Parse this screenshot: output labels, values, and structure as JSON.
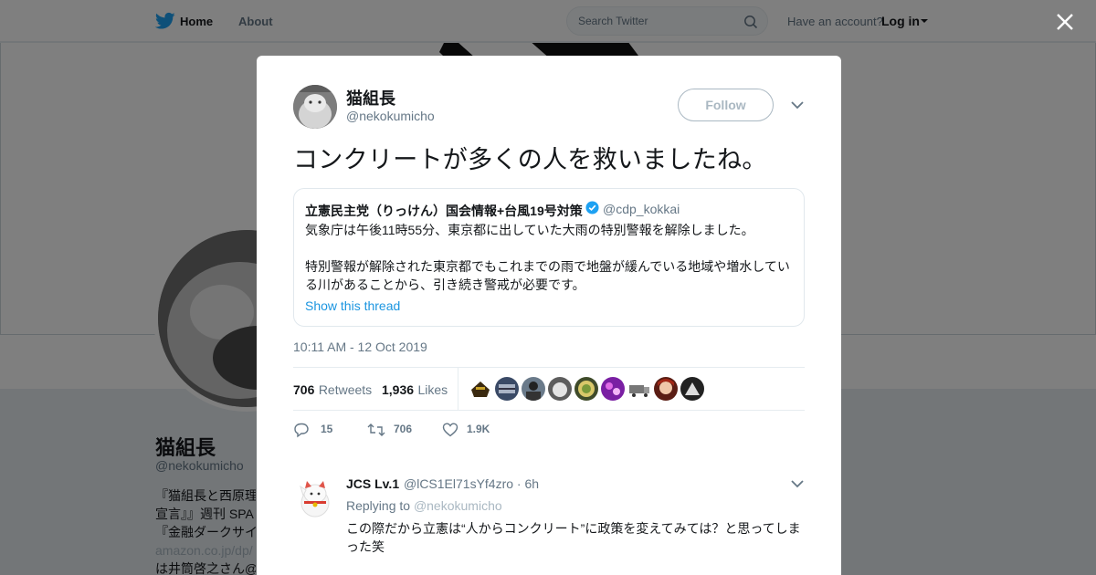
{
  "topbar": {
    "home_label": "Home",
    "about_label": "About",
    "search_placeholder": "Search Twitter",
    "account_prompt": "Have an account?",
    "login_label": "Log in"
  },
  "profile": {
    "name": "猫組長",
    "handle": "@nekokumicho",
    "bio_lines": [
      "『猫組長と西原理",
      "宣言』』週刊 SPA",
      "『金融ダークサイ",
      "amazon.co.jp/dp/",
      "は井筒啓之さん@"
    ]
  },
  "tweet": {
    "author_name": "猫組長",
    "author_handle": "@nekokumicho",
    "follow_label": "Follow",
    "text": "コンクリートが多くの人を救いましたね。",
    "quote": {
      "name": "立憲民主党（りっけん）国会情報+台風19号対策",
      "handle": "@cdp_kokkai",
      "line1": "気象庁は午後11時55分、東京都に出していた大雨の特別警報を解除しました。",
      "line2": "特別警報が解除された東京都でもこれまでの雨で地盤が緩んでいる地域や増水している川があることから、引き続き警戒が必要です。",
      "show_thread": "Show this thread"
    },
    "timestamp": "10:11 AM - 12 Oct 2019",
    "retweets_count": "706",
    "retweets_label": "Retweets",
    "likes_count": "1,936",
    "likes_label": "Likes",
    "actions": {
      "reply_count": "15",
      "retweet_count": "706",
      "like_count": "1.9K"
    }
  },
  "reply": {
    "name": "JCS Lv.1",
    "handle_time": "@lCS1El71sYf4zro · 6h",
    "replying_prefix": "Replying to",
    "replying_to": "@nekokumicho",
    "text": "この際だから立憲は“人からコンクリート”に政策を変えてみては？と思ってしまった笑"
  },
  "colors": {
    "brand_blue": "#1da1f2",
    "link_blue": "#1b95e0",
    "muted": "#657786"
  }
}
